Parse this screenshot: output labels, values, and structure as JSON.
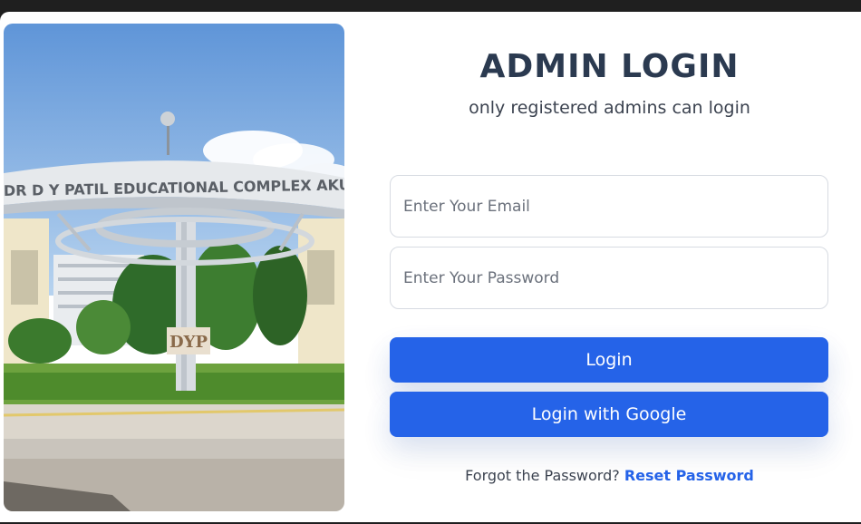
{
  "login": {
    "title": "ADMIN LOGIN",
    "subtitle": "only registered admins can login",
    "email_placeholder": "Enter Your Email",
    "password_placeholder": "Enter Your Password",
    "login_label": "Login",
    "google_label": "Login with Google",
    "forgot_text": "Forgot the Password?",
    "reset_link": "Reset Password"
  },
  "photo": {
    "arch_text": "DR D Y PATIL EDUCATIONAL COMPLEX AKURDI PU",
    "monogram": "DYP"
  },
  "colors": {
    "primary": "#2563e8",
    "title": "#2b3a50"
  }
}
